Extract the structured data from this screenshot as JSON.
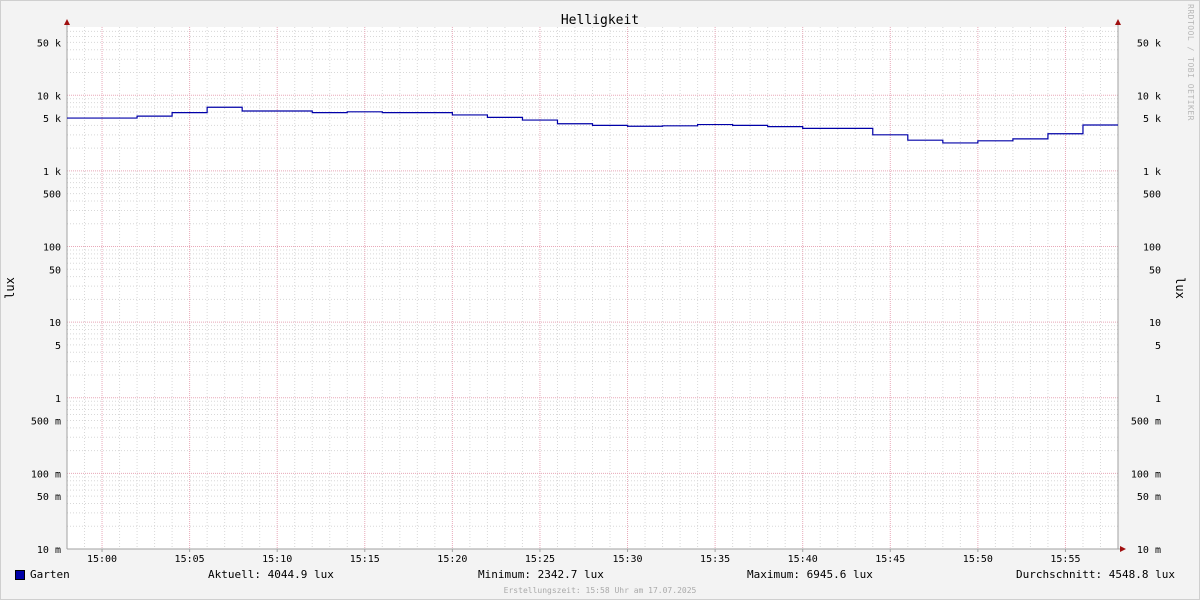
{
  "chart_data": {
    "type": "line",
    "title": "Helligkeit",
    "ylabel": "lux",
    "ylabel_right": "lux",
    "yscale": "log",
    "ylim": [
      0.01,
      80000
    ],
    "x_range": [
      "14:58",
      "15:58"
    ],
    "x_tick_labels": [
      "15:00",
      "15:05",
      "15:10",
      "15:15",
      "15:20",
      "15:25",
      "15:30",
      "15:35",
      "15:40",
      "15:45",
      "15:50",
      "15:55"
    ],
    "y_tick_labels": [
      {
        "value": 50000,
        "label": "50 k"
      },
      {
        "value": 10000,
        "label": "10 k"
      },
      {
        "value": 5000,
        "label": "5 k"
      },
      {
        "value": 1000,
        "label": "1 k"
      },
      {
        "value": 500,
        "label": "500"
      },
      {
        "value": 100,
        "label": "100"
      },
      {
        "value": 50,
        "label": "50"
      },
      {
        "value": 10,
        "label": "10"
      },
      {
        "value": 5,
        "label": "5"
      },
      {
        "value": 1,
        "label": "1"
      },
      {
        "value": 0.5,
        "label": "500 m"
      },
      {
        "value": 0.1,
        "label": "100 m"
      },
      {
        "value": 0.05,
        "label": "50 m"
      },
      {
        "value": 0.01,
        "label": "10 m"
      }
    ],
    "grid": true,
    "series": [
      {
        "name": "Garten",
        "color": "#0000a8",
        "x": [
          "14:58",
          "15:02",
          "15:04",
          "15:06",
          "15:08",
          "15:12",
          "15:14",
          "15:16",
          "15:20",
          "15:22",
          "15:24",
          "15:26",
          "15:28",
          "15:30",
          "15:32",
          "15:34",
          "15:36",
          "15:38",
          "15:40",
          "15:44",
          "15:46",
          "15:48",
          "15:50",
          "15:52",
          "15:54",
          "15:56",
          "15:58"
        ],
        "values": [
          5000,
          5300,
          5900,
          6945.6,
          6200,
          5900,
          6050,
          5900,
          5500,
          5100,
          4700,
          4200,
          4000,
          3900,
          3950,
          4100,
          4000,
          3850,
          3650,
          3000,
          2550,
          2342.7,
          2500,
          2650,
          3100,
          4044.9,
          4044.9
        ]
      }
    ]
  },
  "legend": {
    "series_name": "Garten",
    "current": "Aktuell: 4044.9 lux",
    "minimum": "Minimum: 2342.7 lux",
    "maximum": "Maximum: 6945.6 lux",
    "average": "Durchschnitt: 4548.8 lux"
  },
  "credit": "Erstellungszeit: 15:58 Uhr am 17.07.2025",
  "watermark": "RRDTOOL / TOBI OETIKER",
  "colors": {
    "series": "#0000a8",
    "major_grid": "#e8a8b8",
    "minor_grid": "#d8d8d8",
    "axis": "#a0a0a0",
    "arrow": "#a01010"
  }
}
